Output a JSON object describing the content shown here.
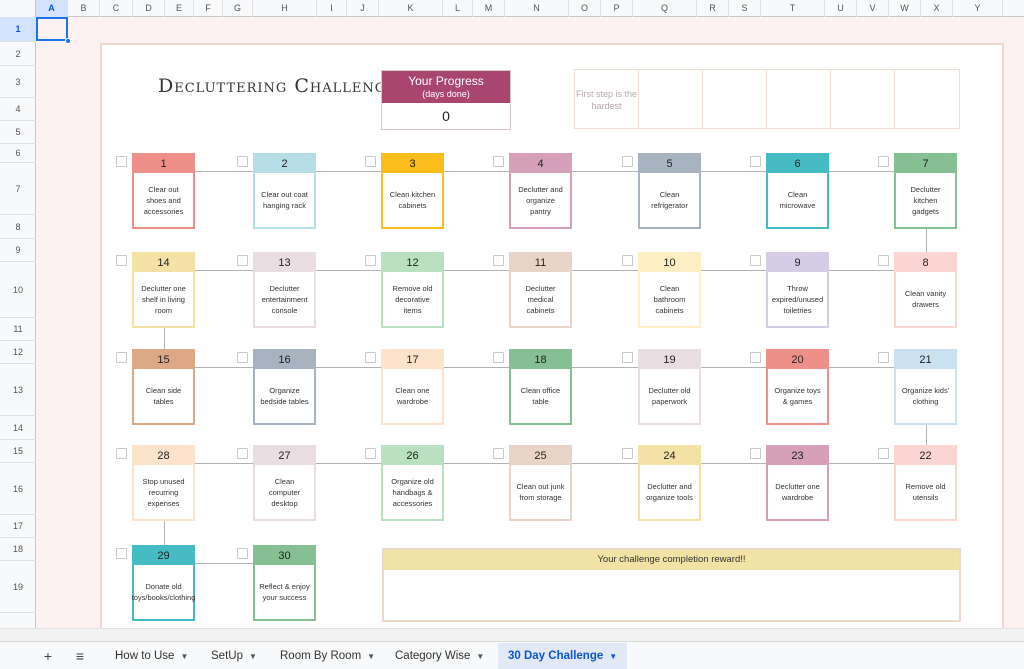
{
  "columns": [
    "A",
    "B",
    "C",
    "D",
    "E",
    "F",
    "G",
    "H",
    "I",
    "J",
    "K",
    "L",
    "M",
    "N",
    "O",
    "P",
    "Q",
    "R",
    "S",
    "T",
    "U",
    "V",
    "W",
    "X",
    "Y"
  ],
  "rows": [
    "1",
    "2",
    "3",
    "4",
    "5",
    "6",
    "7",
    "8",
    "9",
    "10",
    "11",
    "12",
    "13",
    "14",
    "15",
    "16",
    "17",
    "18",
    "19"
  ],
  "selected_cell": "A1",
  "title": "Decluttering Challenge",
  "progress": {
    "label": "Your Progress",
    "sublabel": "(days done)",
    "value": "0"
  },
  "note": "First step is the hardest",
  "days": [
    {
      "n": "1",
      "task": "Clear out shoes and accessories",
      "color": "#ef8f8a"
    },
    {
      "n": "2",
      "task": "Clear out coat hanging rack",
      "color": "#b7dde6"
    },
    {
      "n": "3",
      "task": "Clean kitchen cabinets",
      "color": "#fbbd1c"
    },
    {
      "n": "4",
      "task": "Declutter and organize pantry",
      "color": "#d6a0ba"
    },
    {
      "n": "5",
      "task": "Clean refrigerator",
      "color": "#a7b3be"
    },
    {
      "n": "6",
      "task": "Clean microwave",
      "color": "#45bcc4"
    },
    {
      "n": "7",
      "task": "Declutter kitchen gadgets",
      "color": "#86bf92"
    },
    {
      "n": "8",
      "task": "Clean vanity drawers",
      "color": "#fbd5d2"
    },
    {
      "n": "9",
      "task": "Throw expired/unused toiletries",
      "color": "#d5cde8"
    },
    {
      "n": "10",
      "task": "Clean bathroom cabinets",
      "color": "#fdefc3"
    },
    {
      "n": "11",
      "task": "Declutter medical cabinets",
      "color": "#ead3c9"
    },
    {
      "n": "12",
      "task": "Remove old decorative items",
      "color": "#b8e0c1"
    },
    {
      "n": "13",
      "task": "Declutter entertainment console",
      "color": "#eadde1"
    },
    {
      "n": "14",
      "task": "Declutter one shelf in living room",
      "color": "#f4e2a4"
    },
    {
      "n": "15",
      "task": "Clean side tables",
      "color": "#dca885"
    },
    {
      "n": "16",
      "task": "Organize bedside tables",
      "color": "#a7b3be"
    },
    {
      "n": "17",
      "task": "Clean one wardrobe",
      "color": "#fde2cc"
    },
    {
      "n": "18",
      "task": "Clean office table",
      "color": "#86bf92"
    },
    {
      "n": "19",
      "task": "Declutter old paperwork",
      "color": "#eadde1"
    },
    {
      "n": "20",
      "task": "Organize toys & games",
      "color": "#ef8f8a"
    },
    {
      "n": "21",
      "task": "Organize kids' clothing",
      "color": "#c9e1f1"
    },
    {
      "n": "22",
      "task": "Remove old utensils",
      "color": "#fbd5d2"
    },
    {
      "n": "23",
      "task": "Declutter one wardrobe",
      "color": "#d6a0ba"
    },
    {
      "n": "24",
      "task": "Declutter and organize tools",
      "color": "#f4e2a4"
    },
    {
      "n": "25",
      "task": "Clean out junk from storage",
      "color": "#ead3c9"
    },
    {
      "n": "26",
      "task": "Organize old handbags & accessories",
      "color": "#b8e0c1"
    },
    {
      "n": "27",
      "task": "Clean computer desktop",
      "color": "#eadde1"
    },
    {
      "n": "28",
      "task": "Stop unused recurring expenses",
      "color": "#fde2cc"
    },
    {
      "n": "29",
      "task": "Donate old toys/books/clothing",
      "color": "#45bcc4"
    },
    {
      "n": "30",
      "task": "Reflect & enjoy your success",
      "color": "#86bf92"
    }
  ],
  "reward": {
    "label": "Your challenge completion reward!!"
  },
  "toolbar": {
    "add_sheet": "+",
    "all_sheets": "≡"
  },
  "tabs": [
    {
      "label": "How to Use"
    },
    {
      "label": "SetUp"
    },
    {
      "label": "Room By Room"
    },
    {
      "label": "Category Wise"
    },
    {
      "label": "30 Day Challenge"
    }
  ],
  "active_tab": "30 Day Challenge",
  "tab_arrow": "▼"
}
